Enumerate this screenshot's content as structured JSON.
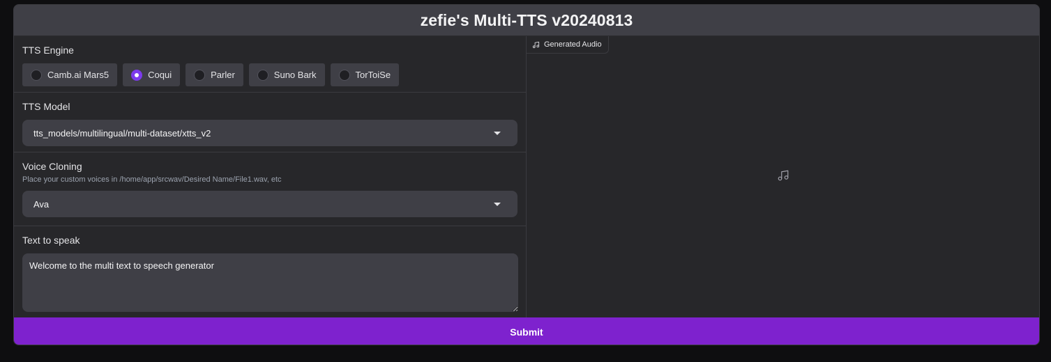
{
  "app": {
    "title": "zefie's Multi-TTS v20240813"
  },
  "engine": {
    "label": "TTS Engine",
    "options": [
      {
        "label": "Camb.ai Mars5",
        "checked": false
      },
      {
        "label": "Coqui",
        "checked": true
      },
      {
        "label": "Parler",
        "checked": false
      },
      {
        "label": "Suno Bark",
        "checked": false
      },
      {
        "label": "TorToiSe",
        "checked": false
      }
    ]
  },
  "model": {
    "label": "TTS Model",
    "value": "tts_models/multilingual/multi-dataset/xtts_v2"
  },
  "voice": {
    "label": "Voice Cloning",
    "hint": "Place your custom voices in /home/app/srcwav/Desired Name/File1.wav, etc",
    "value": "Ava"
  },
  "text": {
    "label": "Text to speak",
    "value": "Welcome to the multi text to speech generator"
  },
  "audio": {
    "label": "Generated Audio",
    "icon": "music-note-icon"
  },
  "submit": {
    "label": "Submit"
  },
  "colors": {
    "accent": "#7e22ce",
    "radio_checked": "#7c3aed",
    "panel": "#27272a",
    "input_bg": "#3f3f46"
  }
}
